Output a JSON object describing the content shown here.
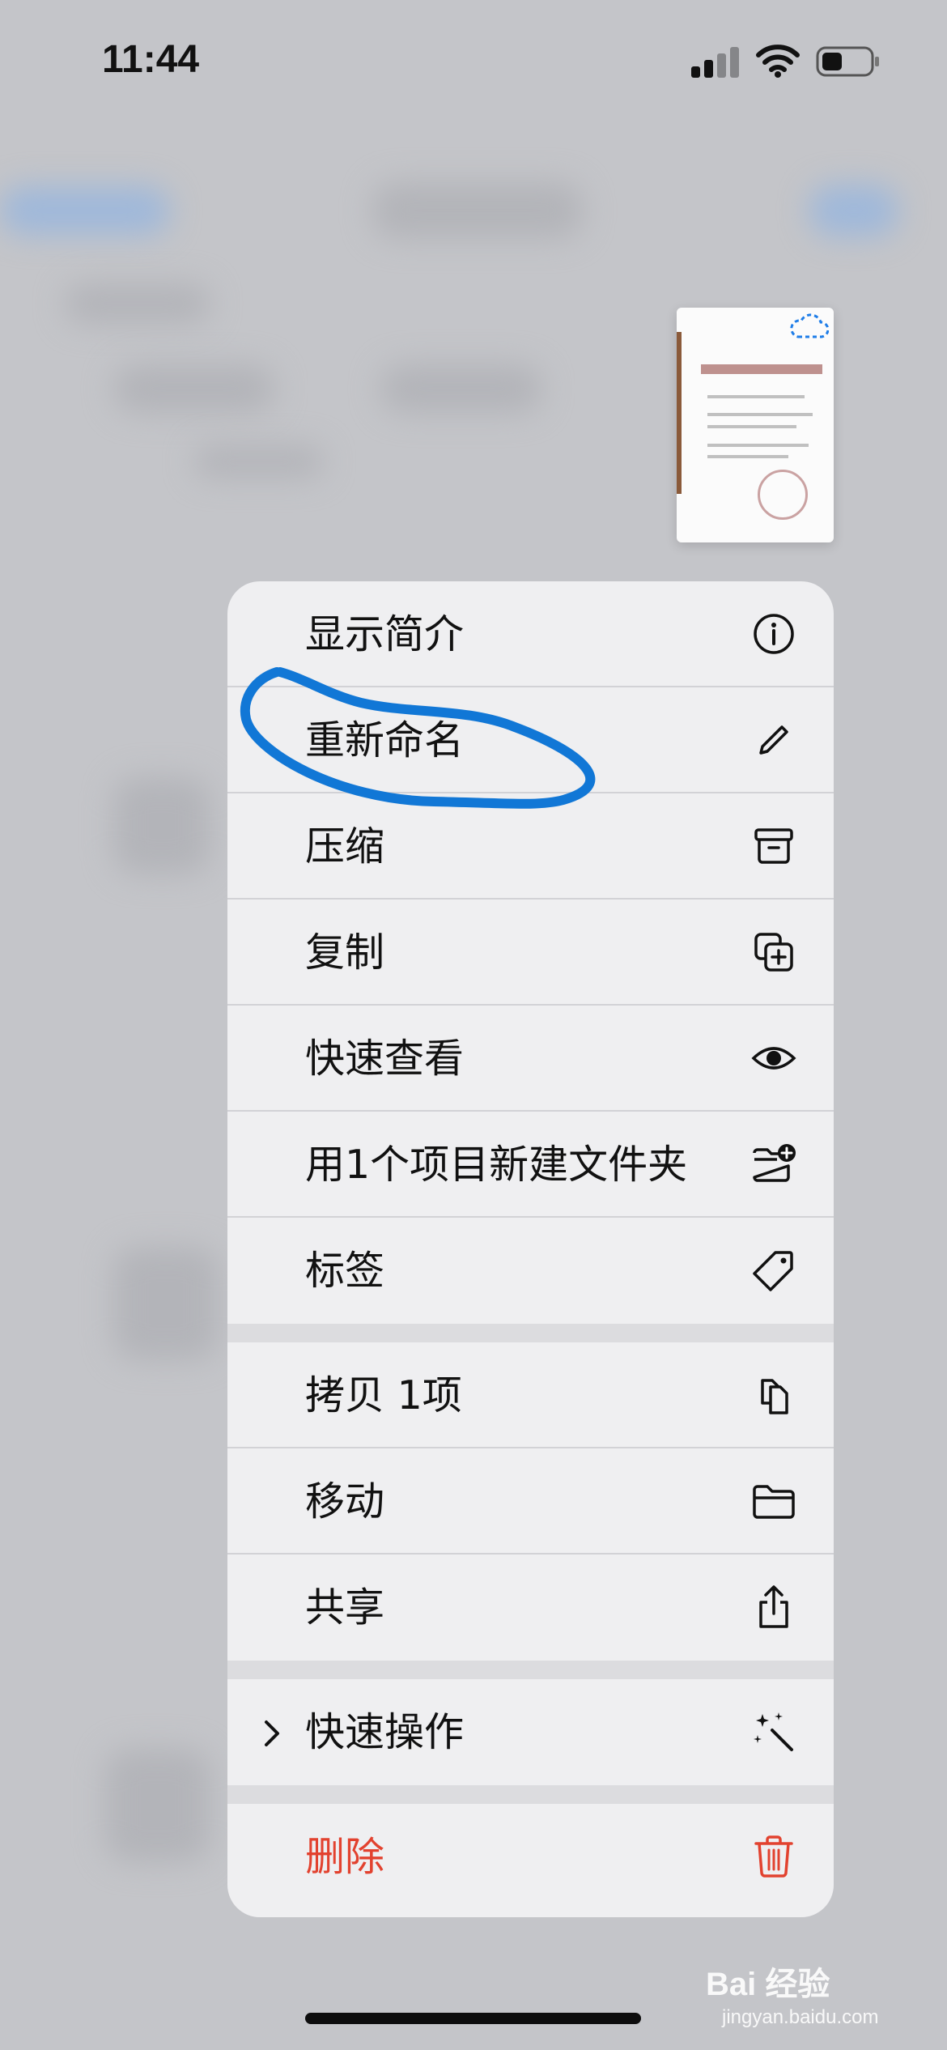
{
  "status_bar": {
    "time": "11:44"
  },
  "menu": {
    "items": [
      {
        "label": "显示简介",
        "icon": "info-icon"
      },
      {
        "label": "重新命名",
        "icon": "pencil-icon"
      },
      {
        "label": "压缩",
        "icon": "archive-box-icon"
      },
      {
        "label": "复制",
        "icon": "duplicate-icon"
      },
      {
        "label": "快速查看",
        "icon": "eye-icon"
      },
      {
        "label": "用1个项目新建文件夹",
        "icon": "folder-add-icon"
      },
      {
        "label": "标签",
        "icon": "tag-icon"
      },
      {
        "label": "拷贝 1项",
        "icon": "copy-docs-icon"
      },
      {
        "label": "移动",
        "icon": "folder-icon"
      },
      {
        "label": "共享",
        "icon": "share-icon"
      },
      {
        "label": "快速操作",
        "icon": "sparkle-wand-icon"
      },
      {
        "label": "删除",
        "icon": "trash-icon"
      }
    ]
  },
  "colors": {
    "destructive": "#e2422f",
    "annotation": "#1177d6"
  },
  "watermark": {
    "brand": "Bai 经验",
    "domain": "jingyan.baidu.com"
  }
}
